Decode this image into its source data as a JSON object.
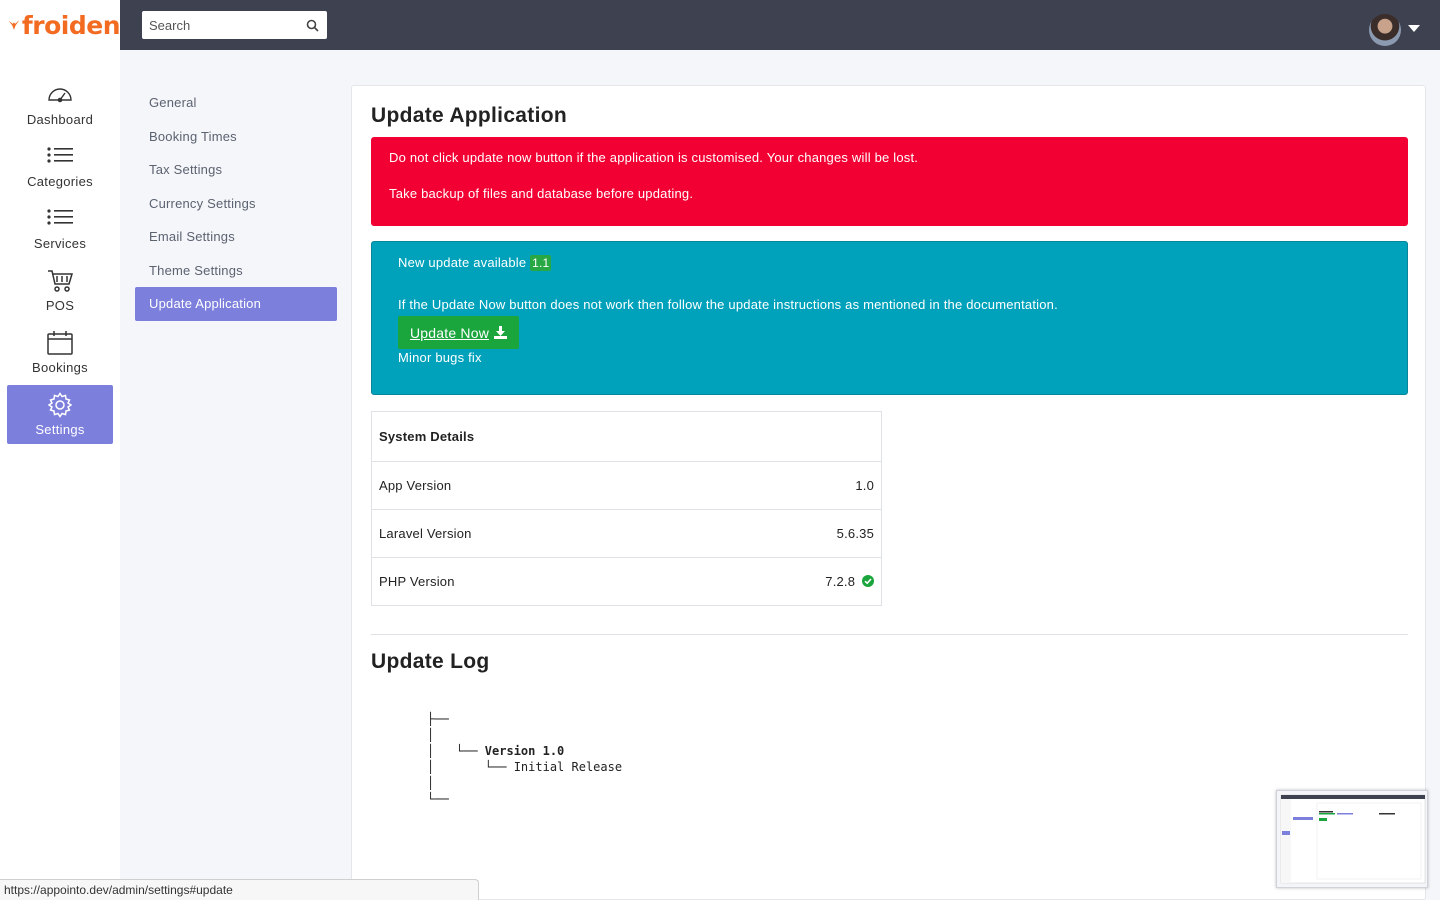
{
  "brand": {
    "name": "froiden"
  },
  "search": {
    "placeholder": "Search"
  },
  "nav": {
    "items": [
      {
        "label": "Dashboard",
        "icon": "speedometer-icon"
      },
      {
        "label": "Categories",
        "icon": "list-icon"
      },
      {
        "label": "Services",
        "icon": "list-icon"
      },
      {
        "label": "POS",
        "icon": "cart-icon"
      },
      {
        "label": "Bookings",
        "icon": "calendar-icon"
      },
      {
        "label": "Settings",
        "icon": "gear-icon",
        "active": true
      }
    ]
  },
  "settings_menu": {
    "items": [
      {
        "label": "General"
      },
      {
        "label": "Booking Times"
      },
      {
        "label": "Tax Settings"
      },
      {
        "label": "Currency Settings"
      },
      {
        "label": "Email Settings"
      },
      {
        "label": "Theme Settings"
      },
      {
        "label": "Update Application",
        "active": true
      }
    ]
  },
  "main": {
    "title": "Update Application",
    "warning": {
      "line1": "Do not click update now button if the application is customised. Your changes will be lost.",
      "line2": "Take backup of files and database before updating."
    },
    "update_info": {
      "available_text": "New update available",
      "version": "1.1",
      "instructions": "If the Update Now button does not work then follow the update instructions as mentioned in the documentation.",
      "button_label": "Update Now",
      "notes": "Minor bugs fix"
    },
    "system_details": {
      "header": "System Details",
      "rows": [
        {
          "label": "App Version",
          "value": "1.0"
        },
        {
          "label": "Laravel Version",
          "value": "5.6.35"
        },
        {
          "label": "PHP Version",
          "value": "7.2.8"
        }
      ]
    },
    "update_log": {
      "title": "Update Log",
      "version_label": "Version 1.0",
      "entry": "Initial Release"
    }
  },
  "status_url": "https://appointo.dev/admin/settings#update",
  "colors": {
    "brand": "#f26b21",
    "topbar": "#3d4150",
    "accent": "#7c7fdc",
    "danger": "#f20033",
    "info": "#00a2bb",
    "success": "#1aa53d"
  }
}
